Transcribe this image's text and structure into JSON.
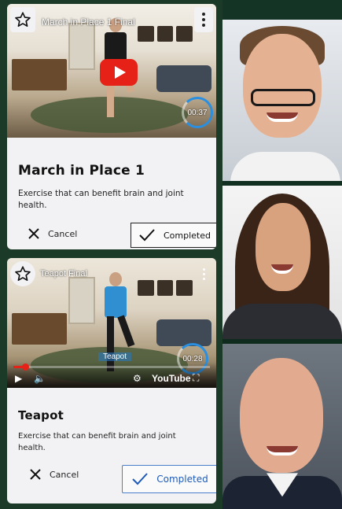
{
  "cards": [
    {
      "video_title": "March in Place 1 Final",
      "timer": "00:37",
      "title": "March in Place 1",
      "description": "Exercise that can benefit brain and joint health.",
      "cancel_label": "Cancel",
      "completed_label": "Completed",
      "completed_style": "outlined-dark"
    },
    {
      "video_title": "Teapot Final",
      "timer": "00:28",
      "caption": "Teapot",
      "youtube_label": "YouTube",
      "progress": 0.06,
      "title": "Teapot",
      "description": "Exercise that can benefit brain and joint health.",
      "cancel_label": "Cancel",
      "completed_label": "Completed",
      "completed_style": "outlined-blue"
    }
  ],
  "colors": {
    "youtube_red": "#e62117",
    "accent_blue": "#1e5bb8",
    "card_bg": "#f2f2f4"
  },
  "participants": [
    {
      "avatar": "man-glasses"
    },
    {
      "avatar": "woman-long-hair"
    },
    {
      "avatar": "bald-man-suit"
    }
  ]
}
